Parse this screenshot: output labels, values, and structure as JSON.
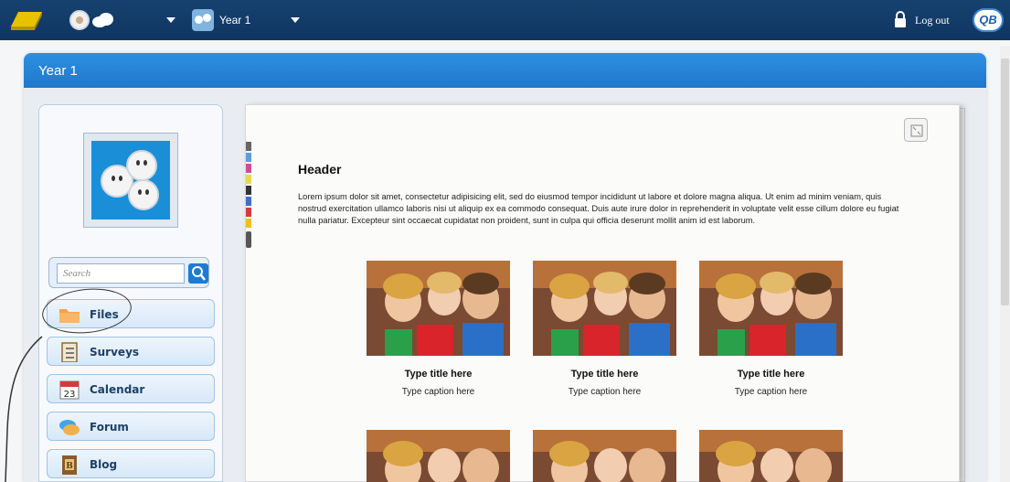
{
  "topbar": {
    "group_label": "Year 1",
    "logout_label": "Log out",
    "brand": "QB"
  },
  "page": {
    "title": "Year 1"
  },
  "sidebar": {
    "search": {
      "placeholder": "Search"
    },
    "items": [
      {
        "label": "Files",
        "icon": "folder-icon"
      },
      {
        "label": "Surveys",
        "icon": "clipboard-icon"
      },
      {
        "label": "Calendar",
        "icon": "calendar-icon",
        "calendar_day": "23"
      },
      {
        "label": "Forum",
        "icon": "speech-bubbles-icon"
      },
      {
        "label": "Blog",
        "icon": "book-icon",
        "book_letter": "B"
      }
    ]
  },
  "document": {
    "header": "Header",
    "body": "Lorem ipsum dolor sit amet, consectetur adipisicing elit, sed do eiusmod tempor incididunt ut labore et dolore magna aliqua. Ut enim ad minim veniam, quis nostrud exercitation ullamco laboris nisi ut aliquip ex ea commodo consequat. Duis aute irure dolor in reprehenderit in voluptate velit esse cillum dolore eu fugiat nulla pariatur. Excepteur sint occaecat cupidatat non proident, sunt in culpa qui officia deserunt mollit anim id est laborum.",
    "gallery": [
      {
        "title": "Type title here",
        "caption": "Type caption here"
      },
      {
        "title": "Type title here",
        "caption": "Type caption here"
      },
      {
        "title": "Type title here",
        "caption": "Type caption here"
      }
    ]
  },
  "colors": {
    "topbar": "#0f3560",
    "header_blue": "#1f78cb",
    "nav_text": "#1d3f66"
  }
}
